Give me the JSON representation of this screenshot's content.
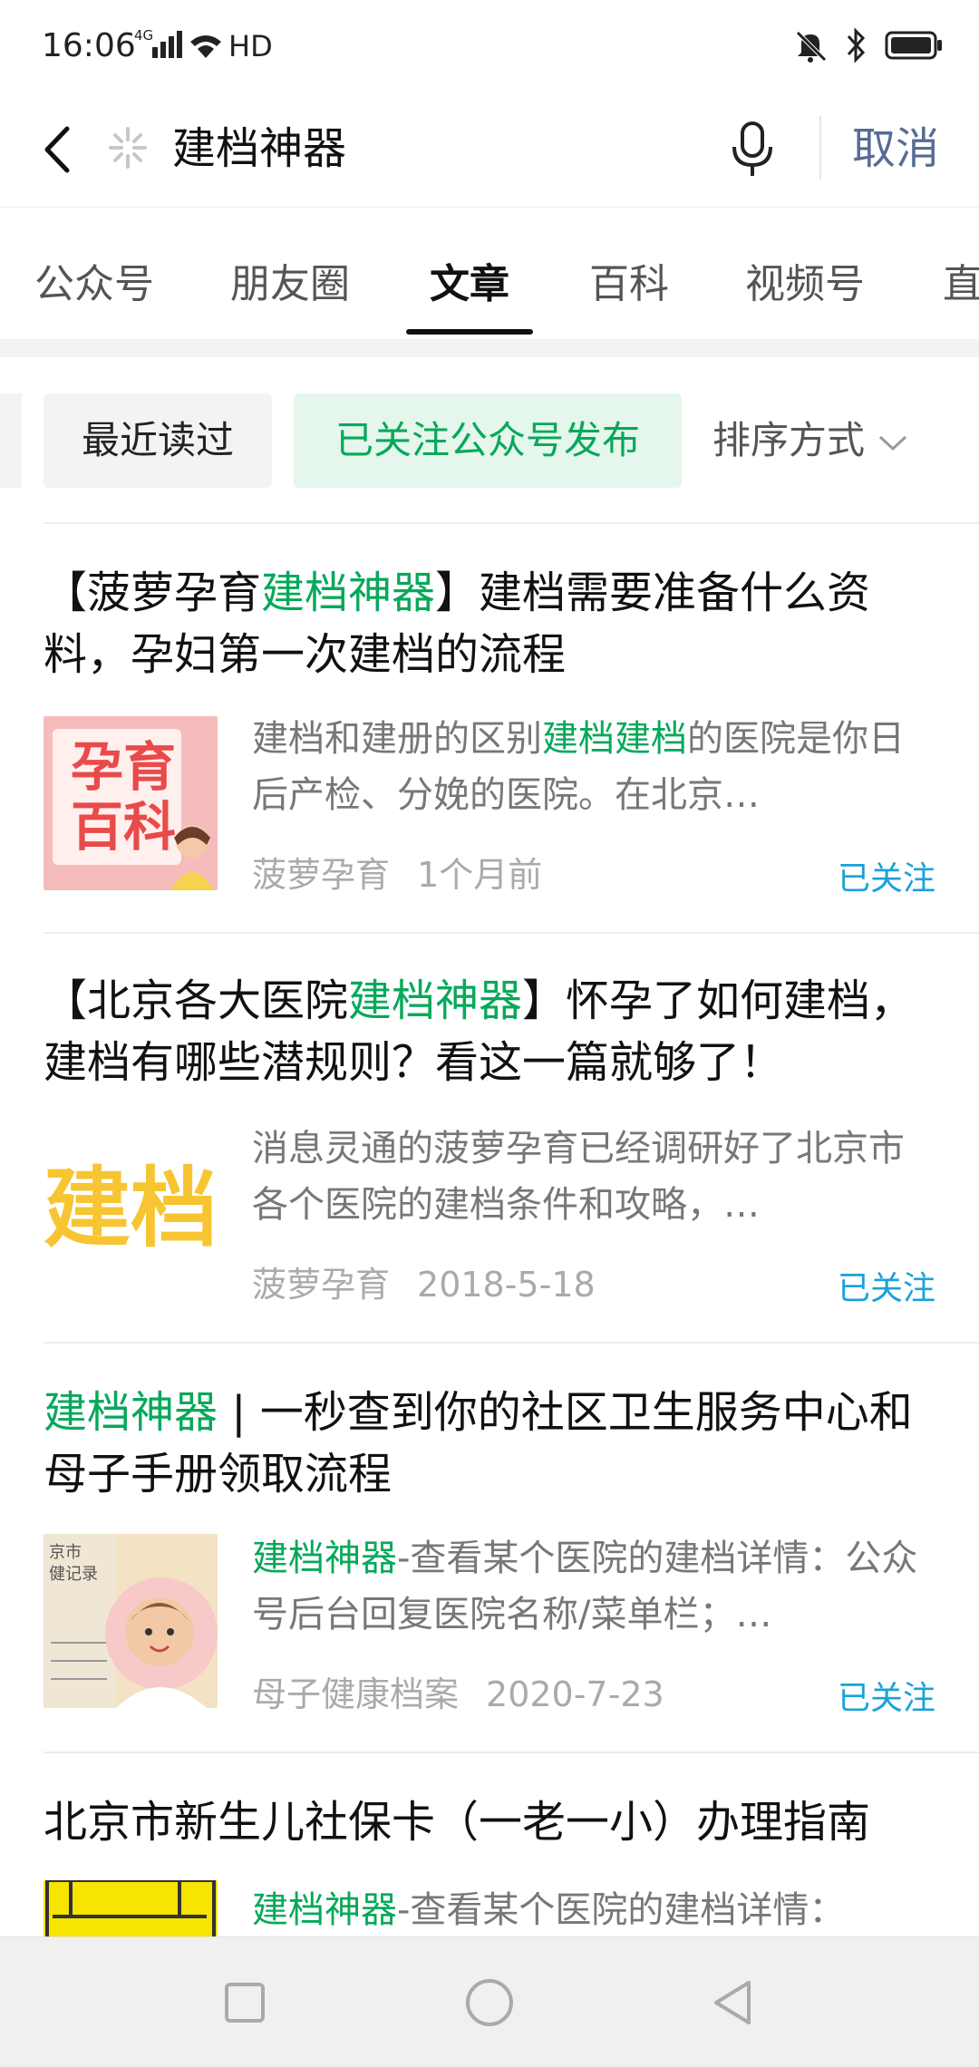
{
  "status_bar": {
    "time": "16:06",
    "network": "4G",
    "wifi_label": "HD",
    "icons": [
      "signal-icon",
      "wifi-icon",
      "mute-icon",
      "bluetooth-icon",
      "battery-icon"
    ]
  },
  "search": {
    "query": "建档神器",
    "cancel_label": "取消"
  },
  "tabs": [
    {
      "label": "公众号",
      "active": false
    },
    {
      "label": "朋友圈",
      "active": false
    },
    {
      "label": "文章",
      "active": true
    },
    {
      "label": "百科",
      "active": false
    },
    {
      "label": "视频号",
      "active": false
    },
    {
      "label": "直",
      "active": false
    }
  ],
  "filters": {
    "recent": "最近读过",
    "followed": "已关注公众号发布",
    "sort": "排序方式"
  },
  "articles": [
    {
      "title_pre": "【菠萝孕育",
      "title_hl": "建档神器",
      "title_post": "】建档需要准备什么资料，孕妇第一次建档的流程",
      "desc_pre": "建档和建册的区别",
      "desc_hl": "建档建档",
      "desc_post": "的医院是你日后产检、分娩的医院。在北京…",
      "source": "菠萝孕育",
      "date": "1个月前",
      "status": "已关注",
      "thumb_text_1": "孕育",
      "thumb_text_2": "百科"
    },
    {
      "title_pre": "【北京各大医院",
      "title_hl": "建档神器",
      "title_post": "】怀孕了如何建档，建档有哪些潜规则？看这一篇就够了！",
      "desc_pre": "消息灵通的菠萝孕育已经调研好了北京市各个医院的建档条件和攻略，…",
      "desc_hl": "",
      "desc_post": "",
      "source": "菠萝孕育",
      "date": "2018-5-18",
      "status": "已关注",
      "thumb_text_1": "建档"
    },
    {
      "title_pre": "",
      "title_hl": "建档神器",
      "title_post": " | 一秒查到你的社区卫生服务中心和母子手册领取流程",
      "desc_pre": "",
      "desc_hl": "建档神器",
      "desc_post": "-查看某个医院的建档详情：公众号后台回复医院名称/菜单栏；…",
      "source": "母子健康档案",
      "date": "2020-7-23",
      "status": "已关注",
      "thumb_text_1": "京市",
      "thumb_text_2": "健记录"
    },
    {
      "title_pre": "北京市新生儿社保卡（一老一小）办理指南",
      "title_hl": "",
      "title_post": "",
      "desc_pre": "",
      "desc_hl": "建档神器",
      "desc_post": "-查看某个医院的建档详情："
    }
  ],
  "colors": {
    "accent_green": "#07a85a",
    "link_blue": "#576b95",
    "followed_blue": "#1aa2d8"
  }
}
